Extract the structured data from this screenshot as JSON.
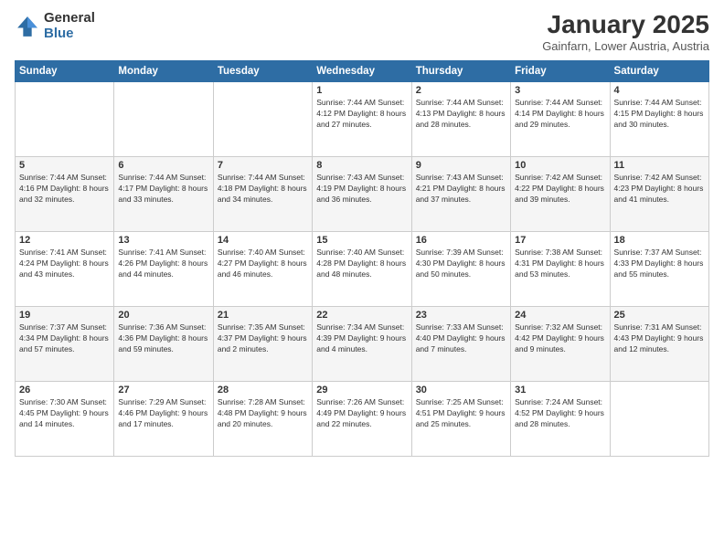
{
  "header": {
    "logo_general": "General",
    "logo_blue": "Blue",
    "month_title": "January 2025",
    "location": "Gainfarn, Lower Austria, Austria"
  },
  "weekdays": [
    "Sunday",
    "Monday",
    "Tuesday",
    "Wednesday",
    "Thursday",
    "Friday",
    "Saturday"
  ],
  "weeks": [
    [
      {
        "day": "",
        "info": ""
      },
      {
        "day": "",
        "info": ""
      },
      {
        "day": "",
        "info": ""
      },
      {
        "day": "1",
        "info": "Sunrise: 7:44 AM\nSunset: 4:12 PM\nDaylight: 8 hours and 27 minutes."
      },
      {
        "day": "2",
        "info": "Sunrise: 7:44 AM\nSunset: 4:13 PM\nDaylight: 8 hours and 28 minutes."
      },
      {
        "day": "3",
        "info": "Sunrise: 7:44 AM\nSunset: 4:14 PM\nDaylight: 8 hours and 29 minutes."
      },
      {
        "day": "4",
        "info": "Sunrise: 7:44 AM\nSunset: 4:15 PM\nDaylight: 8 hours and 30 minutes."
      }
    ],
    [
      {
        "day": "5",
        "info": "Sunrise: 7:44 AM\nSunset: 4:16 PM\nDaylight: 8 hours and 32 minutes."
      },
      {
        "day": "6",
        "info": "Sunrise: 7:44 AM\nSunset: 4:17 PM\nDaylight: 8 hours and 33 minutes."
      },
      {
        "day": "7",
        "info": "Sunrise: 7:44 AM\nSunset: 4:18 PM\nDaylight: 8 hours and 34 minutes."
      },
      {
        "day": "8",
        "info": "Sunrise: 7:43 AM\nSunset: 4:19 PM\nDaylight: 8 hours and 36 minutes."
      },
      {
        "day": "9",
        "info": "Sunrise: 7:43 AM\nSunset: 4:21 PM\nDaylight: 8 hours and 37 minutes."
      },
      {
        "day": "10",
        "info": "Sunrise: 7:42 AM\nSunset: 4:22 PM\nDaylight: 8 hours and 39 minutes."
      },
      {
        "day": "11",
        "info": "Sunrise: 7:42 AM\nSunset: 4:23 PM\nDaylight: 8 hours and 41 minutes."
      }
    ],
    [
      {
        "day": "12",
        "info": "Sunrise: 7:41 AM\nSunset: 4:24 PM\nDaylight: 8 hours and 43 minutes."
      },
      {
        "day": "13",
        "info": "Sunrise: 7:41 AM\nSunset: 4:26 PM\nDaylight: 8 hours and 44 minutes."
      },
      {
        "day": "14",
        "info": "Sunrise: 7:40 AM\nSunset: 4:27 PM\nDaylight: 8 hours and 46 minutes."
      },
      {
        "day": "15",
        "info": "Sunrise: 7:40 AM\nSunset: 4:28 PM\nDaylight: 8 hours and 48 minutes."
      },
      {
        "day": "16",
        "info": "Sunrise: 7:39 AM\nSunset: 4:30 PM\nDaylight: 8 hours and 50 minutes."
      },
      {
        "day": "17",
        "info": "Sunrise: 7:38 AM\nSunset: 4:31 PM\nDaylight: 8 hours and 53 minutes."
      },
      {
        "day": "18",
        "info": "Sunrise: 7:37 AM\nSunset: 4:33 PM\nDaylight: 8 hours and 55 minutes."
      }
    ],
    [
      {
        "day": "19",
        "info": "Sunrise: 7:37 AM\nSunset: 4:34 PM\nDaylight: 8 hours and 57 minutes."
      },
      {
        "day": "20",
        "info": "Sunrise: 7:36 AM\nSunset: 4:36 PM\nDaylight: 8 hours and 59 minutes."
      },
      {
        "day": "21",
        "info": "Sunrise: 7:35 AM\nSunset: 4:37 PM\nDaylight: 9 hours and 2 minutes."
      },
      {
        "day": "22",
        "info": "Sunrise: 7:34 AM\nSunset: 4:39 PM\nDaylight: 9 hours and 4 minutes."
      },
      {
        "day": "23",
        "info": "Sunrise: 7:33 AM\nSunset: 4:40 PM\nDaylight: 9 hours and 7 minutes."
      },
      {
        "day": "24",
        "info": "Sunrise: 7:32 AM\nSunset: 4:42 PM\nDaylight: 9 hours and 9 minutes."
      },
      {
        "day": "25",
        "info": "Sunrise: 7:31 AM\nSunset: 4:43 PM\nDaylight: 9 hours and 12 minutes."
      }
    ],
    [
      {
        "day": "26",
        "info": "Sunrise: 7:30 AM\nSunset: 4:45 PM\nDaylight: 9 hours and 14 minutes."
      },
      {
        "day": "27",
        "info": "Sunrise: 7:29 AM\nSunset: 4:46 PM\nDaylight: 9 hours and 17 minutes."
      },
      {
        "day": "28",
        "info": "Sunrise: 7:28 AM\nSunset: 4:48 PM\nDaylight: 9 hours and 20 minutes."
      },
      {
        "day": "29",
        "info": "Sunrise: 7:26 AM\nSunset: 4:49 PM\nDaylight: 9 hours and 22 minutes."
      },
      {
        "day": "30",
        "info": "Sunrise: 7:25 AM\nSunset: 4:51 PM\nDaylight: 9 hours and 25 minutes."
      },
      {
        "day": "31",
        "info": "Sunrise: 7:24 AM\nSunset: 4:52 PM\nDaylight: 9 hours and 28 minutes."
      },
      {
        "day": "",
        "info": ""
      }
    ]
  ]
}
